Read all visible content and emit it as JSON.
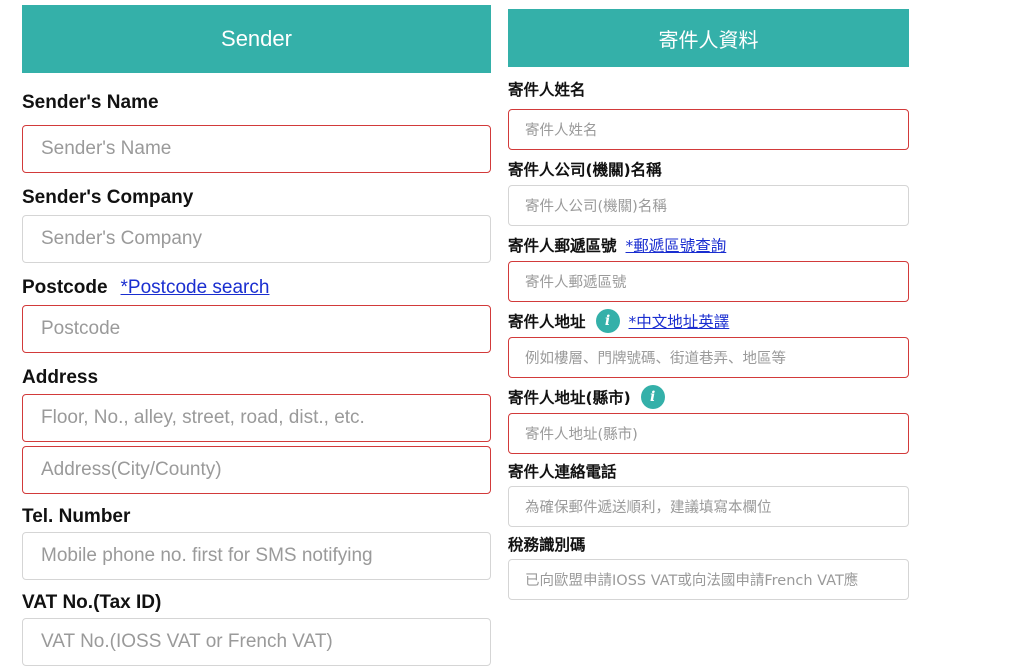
{
  "english_form": {
    "header": "Sender",
    "sender_name": {
      "label": "Sender's Name",
      "placeholder": "Sender's Name"
    },
    "sender_company": {
      "label": "Sender's Company",
      "placeholder": "Sender's Company"
    },
    "postcode": {
      "label": "Postcode",
      "link": "*Postcode search",
      "placeholder": "Postcode"
    },
    "address": {
      "label": "Address",
      "placeholder": "Floor, No., alley, street, road, dist., etc.",
      "city_placeholder": "Address(City/County)"
    },
    "tel": {
      "label": "Tel. Number",
      "placeholder": "Mobile phone no. first for SMS notifying"
    },
    "vat": {
      "label": "VAT No.(Tax ID)",
      "placeholder": "VAT No.(IOSS VAT or French VAT)"
    }
  },
  "chinese_form": {
    "header": "寄件人資料",
    "sender_name": {
      "label": "寄件人姓名",
      "placeholder": "寄件人姓名"
    },
    "sender_company": {
      "label": "寄件人公司(機關)名稱",
      "placeholder": "寄件人公司(機關)名稱"
    },
    "postcode": {
      "label": "寄件人郵遞區號",
      "link": "*郵遞區號查詢",
      "placeholder": "寄件人郵遞區號"
    },
    "address": {
      "label": "寄件人地址",
      "link": "*中文地址英譯",
      "placeholder": "例如樓層、門牌號碼、街道巷弄、地區等"
    },
    "city": {
      "label": "寄件人地址(縣市)",
      "placeholder": "寄件人地址(縣市)"
    },
    "tel": {
      "label": "寄件人連絡電話",
      "placeholder": "為確保郵件遞送順利，建議填寫本欄位"
    },
    "tax_id": {
      "label": "稅務識別碼",
      "placeholder": "已向歐盟申請IOSS VAT或向法國申請French VAT應"
    }
  },
  "colors": {
    "accent": "#34b0a9",
    "required_border": "#d23a3a",
    "link": "#1a2ed0"
  },
  "icons": {
    "info": "info-icon"
  }
}
